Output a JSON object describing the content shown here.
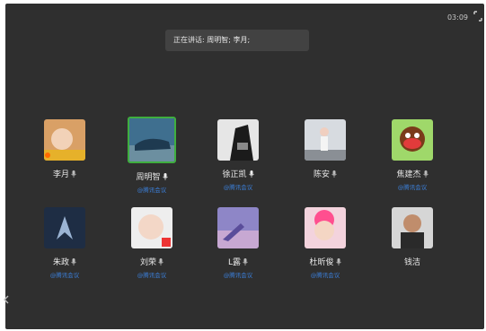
{
  "header": {
    "time": "03:09",
    "speaking_text": "正在讲话: 周明智; 李月;"
  },
  "participants_row1": [
    {
      "name": "李月",
      "sub": ""
    },
    {
      "name": "周明智",
      "sub": "@腾讯会议"
    },
    {
      "name": "徐正凯",
      "sub": "@腾讯会议"
    },
    {
      "name": "陈安",
      "sub": ""
    },
    {
      "name": "焦建杰",
      "sub": "@腾讯会议"
    }
  ],
  "participants_row2": [
    {
      "name": "朱政",
      "sub": "@腾讯会议"
    },
    {
      "name": "刘荣",
      "sub": "@腾讯会议"
    },
    {
      "name": "L露",
      "sub": "@腾讯会议"
    },
    {
      "name": "杜昕俊",
      "sub": "@腾讯会议"
    },
    {
      "name": "钱洁",
      "sub": ""
    }
  ],
  "icons": {
    "mic": "mic-icon",
    "fullscreen": "fullscreen-icon"
  },
  "colors": {
    "background": "#2f2f2f",
    "active_border": "#3fae3f",
    "meta_text": "#3b7fd9"
  }
}
